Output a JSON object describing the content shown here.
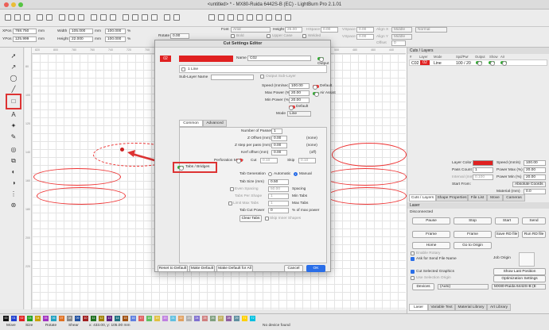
{
  "window": {
    "title": "<untitled> * - MX80-Ruida 6442S-B (EC) - LightBurn Pro 2.1.01"
  },
  "toolbar2": {
    "xpos_label": "XPos",
    "xpos_value": "768.750",
    "xpos_unit": "mm",
    "ypos_label": "YPos",
    "ypos_value": "125.999",
    "ypos_unit": "mm",
    "width_label": "Width",
    "width_value": "105.000",
    "width_unit": "mm",
    "width_pct": "100.000",
    "height_label": "Height",
    "height_value": "22.000",
    "height_unit": "mm",
    "height_pct": "100.000",
    "rotate_label": "Rotate",
    "rotate_value": "0.00",
    "font_label": "Font",
    "font_value": "Arial",
    "height2_label": "Height",
    "height2_value": "25.00",
    "hspace_label": "HSpace",
    "hspace_value": "0.00",
    "vspace_label": "VSpace",
    "vspace_value": "0.00",
    "alignx_label": "Align X",
    "alignx_value": "Middle",
    "aligny_label": "Align Y",
    "aligny_value": "Middle",
    "offset_label": "Offset",
    "offset_value": "0",
    "normal_label": "Normal",
    "bold_label": "Bold",
    "italic_label": "Italic",
    "uppercase_label": "Upper Case",
    "distort_label": "Distort",
    "welded_label": "Welded"
  },
  "ruler": {
    "top": [
      "820",
      "800",
      "780",
      "760",
      "740",
      "720",
      "700",
      "680",
      "660",
      "640",
      "620",
      "600",
      "580",
      "560",
      "540",
      "520",
      "500",
      "480",
      "460",
      "440",
      "420",
      "400"
    ],
    "left": [
      "80",
      "100",
      "120",
      "140",
      "160",
      "180",
      "200",
      "220",
      "240",
      "260",
      "280",
      "300"
    ]
  },
  "cuts_panel": {
    "title": "Cuts / Layers",
    "columns": [
      "#",
      "Layer",
      "Mode",
      "Spd/Pwr",
      "Output",
      "Show",
      "Air"
    ],
    "row": {
      "num": "C02",
      "layer": "02",
      "mode": "Line",
      "spdpwr": "100 / 20"
    },
    "layer_color_label": "Layer Color",
    "speed_label": "Speed (mm/s)",
    "speed_value": "100.00",
    "pass_count_label": "Pass Count",
    "pass_count_value": "1",
    "max_power_label": "Power Max (%)",
    "max_power_value": "20.00",
    "interval_label": "Interval (mm)",
    "interval_value": "0.100",
    "min_power_label": "Power Min (%)",
    "min_power_value": "20.00",
    "start_from_label": "Start From:",
    "start_from_value": "Absolute Coords",
    "material_label": "Material (mm)",
    "material_value": "0.0",
    "tabs": [
      "Cuts / Layers",
      "Shape Properties",
      "File List",
      "Move",
      "Cameras"
    ]
  },
  "laser_panel": {
    "title": "Laser",
    "status": "Disconnected",
    "pause": "Pause",
    "stop": "Stop",
    "start": "Start",
    "send": "Send",
    "frame1": "Frame",
    "frame2": "Frame",
    "save_rd": "Save RD file",
    "run_rd": "Run RD file",
    "home": "Home",
    "go_origin": "Go to Origin",
    "enable_rotary": "Enable Rotary",
    "ask_send": "Ask for Send File Name",
    "job_origin": "Job Origin",
    "cut_selected": "Cut Selected Graphics",
    "use_sel_origin": "Use Selection Origin",
    "show_last": "Show Last Position",
    "opt_settings": "Optimization Settings",
    "devices": "Devices",
    "auto": "(Auto)",
    "device_name": "MX80-Ruida 6442S-B (E",
    "tabs": [
      "Laser",
      "Variable Text",
      "Material Library",
      "Art Library"
    ]
  },
  "status": {
    "move": "Move",
    "size": "Size",
    "rotate": "Rotate",
    "shear": "Shear",
    "coords": "x: 433.00, y: 105.00 mm",
    "device": "No device found",
    "swatches": [
      "00",
      "01",
      "02",
      "03",
      "04",
      "05",
      "06",
      "07",
      "08",
      "09",
      "10",
      "11",
      "12",
      "13",
      "14",
      "15",
      "16",
      "17",
      "18",
      "19",
      "20",
      "21",
      "22",
      "23",
      "24",
      "25",
      "26",
      "27",
      "28",
      "29",
      "T1",
      "T2"
    ],
    "swatch_colors": [
      "#111111",
      "#1f3fd0",
      "#e02020",
      "#20a020",
      "#c8a000",
      "#a030c0",
      "#20a0c0",
      "#e07020",
      "#888888",
      "#2050a0",
      "#a02020",
      "#207020",
      "#a08000",
      "#602080",
      "#207080",
      "#a05010",
      "#6080e0",
      "#e06060",
      "#60c060",
      "#e0c040",
      "#c080e0",
      "#60c0e0",
      "#e0a060",
      "#b0b0b0",
      "#8070d0",
      "#d08080",
      "#80a080",
      "#c0b060",
      "#9060a0",
      "#6090a0",
      "#ffd000",
      "#00c0e0"
    ]
  },
  "dialog": {
    "title": "Cut Settings Editor",
    "layer_num": "02",
    "name_label": "Name",
    "name_value": "C02",
    "output_label": "Output",
    "sublayer_label": "1 Line",
    "output_sublayer": "Output Sub-Layer",
    "sublayer_name_label": "Sub-Layer Name",
    "speed_label": "Speed (mm/sec)",
    "speed_value": "100.00",
    "default_label": "Default",
    "maxpower_label": "Max Power (%)",
    "maxpower_value": "20.00",
    "air_label": "Air Assist",
    "minpower_label": "Min Power (%)",
    "minpower_value": "20.00",
    "default2_label": "Default",
    "mode_label": "Mode",
    "mode_value": "Line",
    "tab_common": "Common",
    "tab_advanced": "Advanced",
    "passes_label": "Number of Passes",
    "passes_value": "1",
    "zoffset_label": "Z Offset (mm)",
    "zoffset_value": "0.00",
    "zoffset_note": "(none)",
    "zstep_label": "Z step per pass (mm)",
    "zstep_value": "0.00",
    "zstep_note": "(none)",
    "kerf_label": "Kerf offset (mm)",
    "kerf_value": "0.00",
    "kerf_note": "(off)",
    "perforation_label": "Perforation Mode",
    "cut_label": "Cut",
    "cut_value": "0.10",
    "skip_label": "Skip",
    "skip_value": "0.10",
    "tabs_bridges_label": "Tabs / Bridges",
    "tab_gen_label": "Tab Generation",
    "tab_gen_auto": "Automatic",
    "tab_gen_manual": "Manual",
    "tab_size_label": "Tab Size (mm)",
    "tab_size_value": "0.50",
    "even_spacing_label": "Even Spacing",
    "even_spacing_value": "50.00",
    "spacing_label": "Spacing",
    "tabs_per_shape_label": "Tabs Per Shape",
    "tabs_per_shape_value": "1",
    "min_tabs_label": "Min Tabs",
    "limit_max_label": "Limit Max Tabs",
    "limit_max_value": "1",
    "max_tabs_label": "Max Tabs",
    "tab_cut_power_label": "Tab Cut Power",
    "tab_cut_power_value": "0",
    "tab_cut_power_unit": "% of max power",
    "clear_tabs": "Clear Tabs",
    "skip_inner": "Skip Inner Shapes",
    "reset_default": "Reset to Default",
    "make_default": "Make Default",
    "make_default_all": "Make Default for All",
    "cancel": "Cancel",
    "ok": "OK"
  },
  "colors": {
    "accent_red": "#e02020",
    "highlight_red": "#d33",
    "toggle_green": "#33aa33",
    "ok_blue": "#2a6ee8"
  }
}
